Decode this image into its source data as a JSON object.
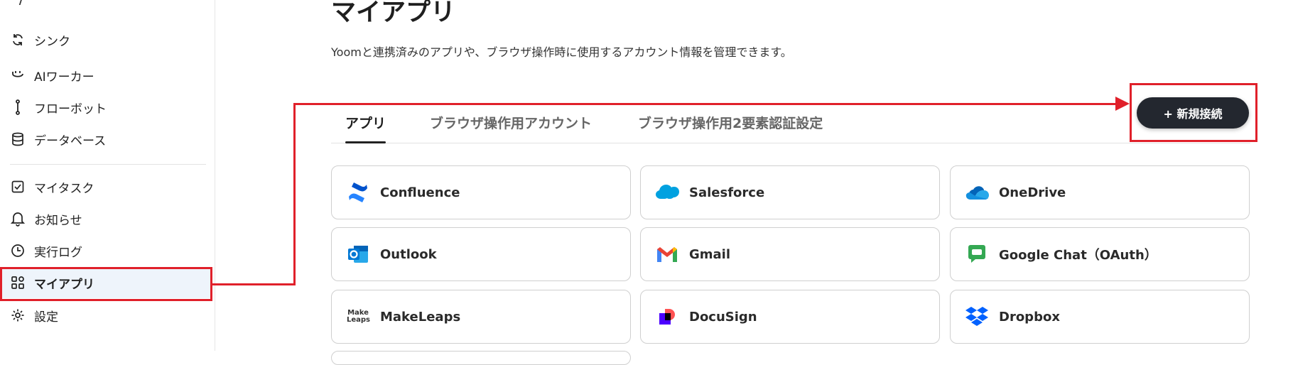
{
  "sidebar": {
    "top_fragment": "ϟ",
    "items": [
      {
        "label": "シンク",
        "icon": "sync-icon"
      },
      {
        "label": "AIワーカー",
        "icon": "ai-worker-icon"
      },
      {
        "label": "フローボット",
        "icon": "flowbot-icon"
      },
      {
        "label": "データベース",
        "icon": "database-icon"
      },
      {
        "label": "マイタスク",
        "icon": "checkbox-icon"
      },
      {
        "label": "お知らせ",
        "icon": "bell-icon"
      },
      {
        "label": "実行ログ",
        "icon": "clock-icon"
      },
      {
        "label": "マイアプリ",
        "icon": "apps-grid-icon",
        "active": true
      },
      {
        "label": "設定",
        "icon": "gear-icon"
      }
    ]
  },
  "main": {
    "title": "マイアプリ",
    "description": "Yoomと連携済みのアプリや、ブラウザ操作時に使用するアカウント情報を管理できます。",
    "tabs": [
      {
        "label": "アプリ",
        "active": true
      },
      {
        "label": "ブラウザ操作用アカウント"
      },
      {
        "label": "ブラウザ操作用2要素認証設定"
      }
    ],
    "new_connection_label": "+ 新規接続",
    "apps": [
      {
        "name": "Confluence",
        "icon": "confluence-icon"
      },
      {
        "name": "Salesforce",
        "icon": "salesforce-icon"
      },
      {
        "name": "OneDrive",
        "icon": "onedrive-icon"
      },
      {
        "name": "Outlook",
        "icon": "outlook-icon"
      },
      {
        "name": "Gmail",
        "icon": "gmail-icon"
      },
      {
        "name": "Google Chat（OAuth）",
        "icon": "google-chat-icon"
      },
      {
        "name": "MakeLeaps",
        "icon": "makeleaps-icon",
        "logo_text": "Make Leaps"
      },
      {
        "name": "DocuSign",
        "icon": "docusign-icon"
      },
      {
        "name": "Dropbox",
        "icon": "dropbox-icon"
      }
    ]
  },
  "colors": {
    "annotation": "#e0202a",
    "button_bg": "#23272f",
    "active_nav_bg": "#eef4fb"
  }
}
